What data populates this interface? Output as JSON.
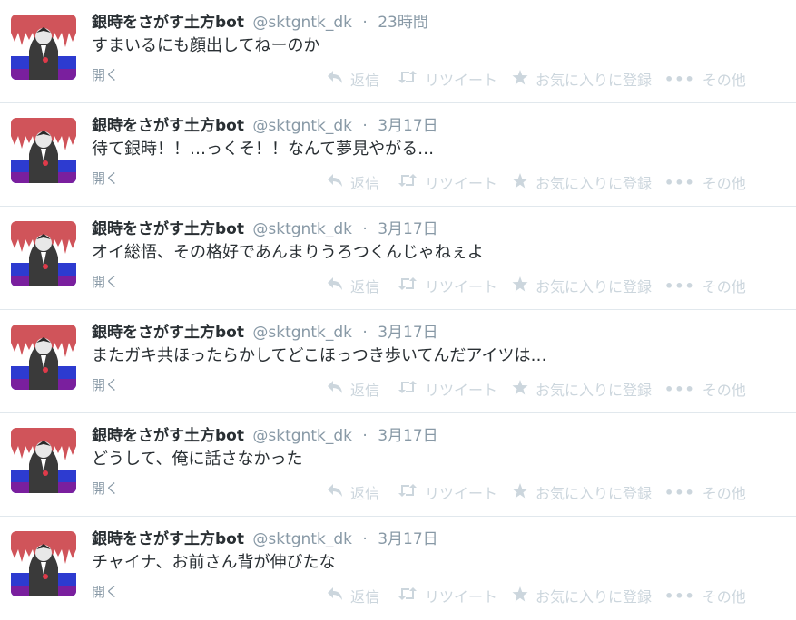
{
  "action_labels": {
    "expand": "開く",
    "reply": "返信",
    "retweet": "リツイート",
    "favorite": "お気に入りに登録",
    "more": "その他"
  },
  "icons": {
    "reply": "reply-icon",
    "retweet": "retweet-icon",
    "favorite": "star-icon",
    "more": "more-dots-icon"
  },
  "colors": {
    "name": "#292f33",
    "meta": "#8899a6",
    "action": "#ccd6dd",
    "divider": "#e1e8ed"
  },
  "tweets": [
    {
      "name": "銀時をさがす土方bot",
      "handle": "@sktgntk_dk",
      "time": "23時間",
      "text": "すまいるにも顔出してねーのか"
    },
    {
      "name": "銀時をさがす土方bot",
      "handle": "@sktgntk_dk",
      "time": "3月17日",
      "text": "待て銀時！！…っくそ！！なんて夢見やがる…"
    },
    {
      "name": "銀時をさがす土方bot",
      "handle": "@sktgntk_dk",
      "time": "3月17日",
      "text": "オイ総悟、その格好であんまりうろつくんじゃねぇよ"
    },
    {
      "name": "銀時をさがす土方bot",
      "handle": "@sktgntk_dk",
      "time": "3月17日",
      "text": "またガキ共ほったらかしてどこほっつき歩いてんだアイツは…"
    },
    {
      "name": "銀時をさがす土方bot",
      "handle": "@sktgntk_dk",
      "time": "3月17日",
      "text": "どうして、俺に話さなかった"
    },
    {
      "name": "銀時をさがす土方bot",
      "handle": "@sktgntk_dk",
      "time": "3月17日",
      "text": "チャイナ、お前さん背が伸びたな"
    }
  ]
}
